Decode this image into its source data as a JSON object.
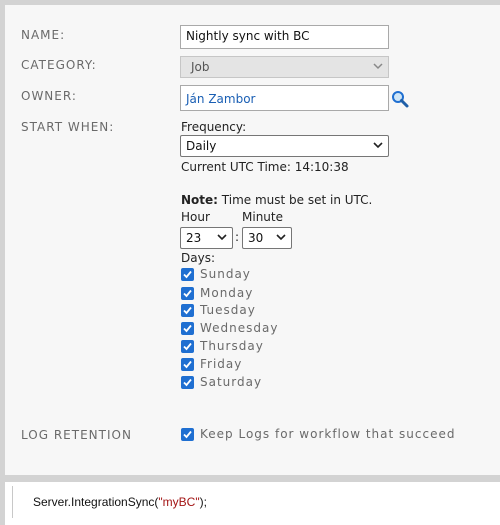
{
  "form": {
    "name_label": "NAME:",
    "name_value": "Nightly sync with BC",
    "category_label": "CATEGORY:",
    "category_value": "Job",
    "owner_label": "OWNER:",
    "owner_value": "Ján Zambor",
    "start_label": "START WHEN:",
    "frequency_label": "Frequency:",
    "frequency_value": "Daily",
    "utc_time": "Current UTC Time: 14:10:38",
    "note_bold": "Note:",
    "note_text": " Time must be set in UTC.",
    "hour_label": "Hour",
    "minute_label": "Minute",
    "hour_value": "23",
    "minute_value": "30",
    "time_separator": ":",
    "days_label": "Days:",
    "days": [
      {
        "label": "Sunday",
        "checked": true
      },
      {
        "label": "Monday",
        "checked": true
      },
      {
        "label": "Tuesday",
        "checked": true
      },
      {
        "label": "Wednesday",
        "checked": true
      },
      {
        "label": "Thursday",
        "checked": true
      },
      {
        "label": "Friday",
        "checked": true
      },
      {
        "label": "Saturday",
        "checked": true
      }
    ],
    "log_label": "LOG RETENTION",
    "log_checkbox_label": "Keep Logs for workflow that succeed",
    "log_checked": true
  },
  "code": {
    "prefix": "Server.IntegrationSync(",
    "string": "\"myBC\"",
    "suffix": ");"
  },
  "colors": {
    "accent": "#1f6fd1",
    "link": "#1a5fb4",
    "label": "#6a6a6a",
    "code_string": "#a31515"
  },
  "icons": {
    "owner_lookup": "magnifier-icon",
    "select": "chevron-down-icon",
    "checkbox": "checkmark-icon"
  }
}
